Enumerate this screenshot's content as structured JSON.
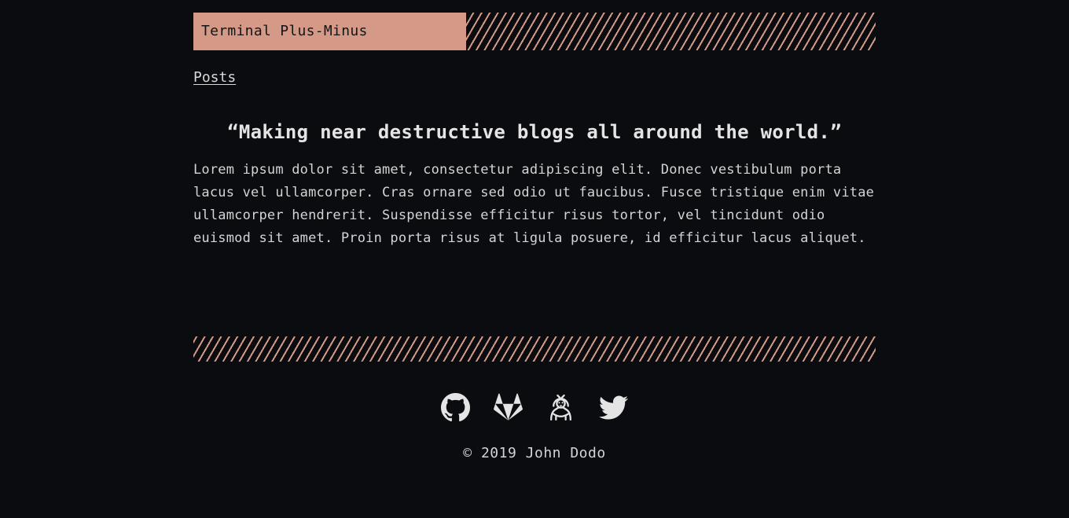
{
  "site": {
    "title": "Terminal Plus-Minus"
  },
  "nav": {
    "items": [
      {
        "label": "Posts"
      }
    ]
  },
  "main": {
    "tagline": "“Making near destructive blogs all around the world.”",
    "body": "Lorem ipsum dolor sit amet, consectetur adipiscing elit. Donec vestibulum porta lacus vel ullamcorper. Cras ornare sed odio ut faucibus. Fusce tristique enim vitae ullamcorper hendrerit. Suspendisse efficitur risus tortor, vel tincidunt odio euismod sit amet. Proin porta risus at ligula posuere, id efficitur lacus aliquet."
  },
  "footer": {
    "social": [
      {
        "icon": "github-icon"
      },
      {
        "icon": "gitlab-icon"
      },
      {
        "icon": "mastodon-icon"
      },
      {
        "icon": "twitter-icon"
      }
    ],
    "copyright": "© 2019 John Dodo"
  },
  "colors": {
    "background": "#0b0c10",
    "accent": "#d49a87",
    "text": "#d8d8d8"
  }
}
